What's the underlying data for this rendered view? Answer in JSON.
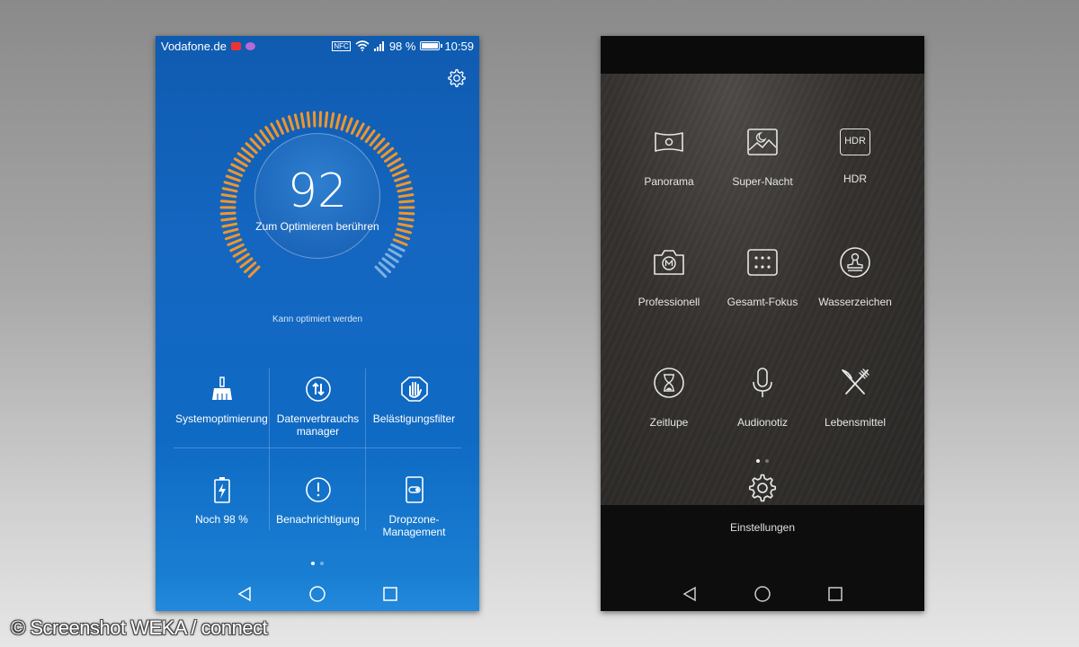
{
  "left_phone": {
    "status": {
      "carrier": "Vodafone.de",
      "nfc": "NFC",
      "battery_percent": "98 %",
      "time": "10:59"
    },
    "score": "92",
    "score_hint": "Zum Optimieren berühren",
    "status_text": "Kann optimiert werden",
    "tiles": [
      {
        "label": "Systemoptimierung",
        "icon": "broom-icon"
      },
      {
        "label": "Datenverbrauchs manager",
        "icon": "data-arrows-icon"
      },
      {
        "label": "Belästigungsfilter",
        "icon": "hand-block-icon"
      },
      {
        "label": "Noch 98 %",
        "icon": "battery-charge-icon"
      },
      {
        "label": "Benachrichtigung",
        "icon": "exclamation-icon"
      },
      {
        "label": "Dropzone-Management",
        "icon": "phone-toggle-icon"
      }
    ],
    "page_dots": 2,
    "active_page": 1
  },
  "right_phone": {
    "modes": [
      {
        "label": "Panorama",
        "icon": "panorama-icon"
      },
      {
        "label": "Super-Nacht",
        "icon": "night-image-icon"
      },
      {
        "label": "HDR",
        "icon": "hdr-icon"
      },
      {
        "label": "Professionell",
        "icon": "camera-m-icon"
      },
      {
        "label": "Gesamt-Fokus",
        "icon": "dot-grid-icon"
      },
      {
        "label": "Wasserzeichen",
        "icon": "stamp-icon"
      },
      {
        "label": "Zeitlupe",
        "icon": "hourglass-icon"
      },
      {
        "label": "Audionotiz",
        "icon": "microphone-icon"
      },
      {
        "label": "Lebensmittel",
        "icon": "fork-knife-icon"
      }
    ],
    "hdr_text": "HDR",
    "settings_label": "Einstellungen",
    "page_dots": 2,
    "active_page": 1
  },
  "credit": "© Screenshot WEKA / connect",
  "colors": {
    "gauge_active": "#f0962c",
    "gauge_inactive": "#7fb0e0",
    "accent_blue": "#1466c0"
  }
}
